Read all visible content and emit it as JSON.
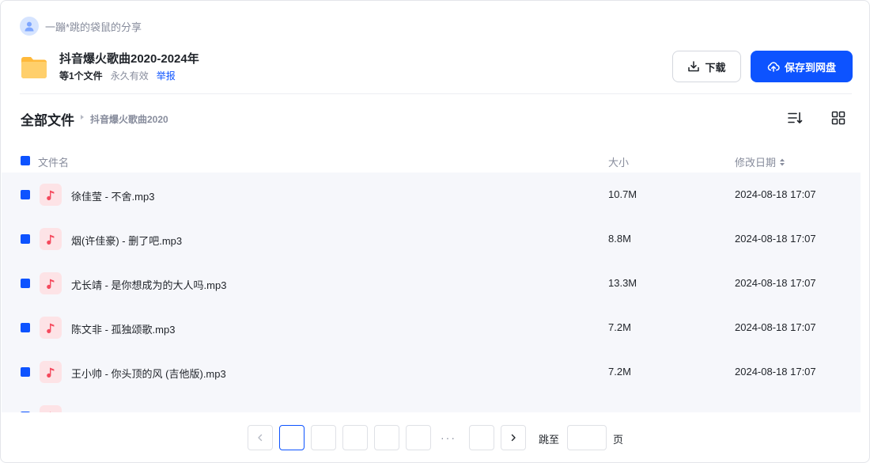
{
  "sharer": {
    "name": "一蹦*跳的袋鼠的分享",
    "icon": "user-avatar-icon"
  },
  "share": {
    "title": "抖音爆火歌曲2020-2024年",
    "count": "等1个文件",
    "validity": "永久有效",
    "report": "举报",
    "icon": "folder-icon"
  },
  "actions": {
    "download_label": "下载",
    "save_label": "保存到网盘"
  },
  "breadcrumb": {
    "root": "全部文件",
    "current": "抖音爆火歌曲2020"
  },
  "table": {
    "columns": {
      "name": "文件名",
      "size": "大小",
      "date": "修改日期"
    },
    "rows": [
      {
        "name": "徐佳莹 - 不舍.mp3",
        "size": "10.7M",
        "date": "2024-08-18 17:07"
      },
      {
        "name": "烟(许佳豪) - 删了吧.mp3",
        "size": "8.8M",
        "date": "2024-08-18 17:07"
      },
      {
        "name": "尤长靖 - 是你想成为的大人吗.mp3",
        "size": "13.3M",
        "date": "2024-08-18 17:07"
      },
      {
        "name": "陈文非 - 孤独颂歌.mp3",
        "size": "7.2M",
        "date": "2024-08-18 17:07"
      },
      {
        "name": "王小帅 - 你头顶的风 (吉他版).mp3",
        "size": "7.2M",
        "date": "2024-08-18 17:07"
      }
    ]
  },
  "pagination": {
    "dots": "···",
    "jump_label": "跳至",
    "page_label": "页",
    "jump_value": ""
  },
  "colors": {
    "accent": "#0d53ff",
    "folder": "#ffc55a",
    "music_icon": "#f5495d",
    "row_bg": "#f6f7fb"
  }
}
